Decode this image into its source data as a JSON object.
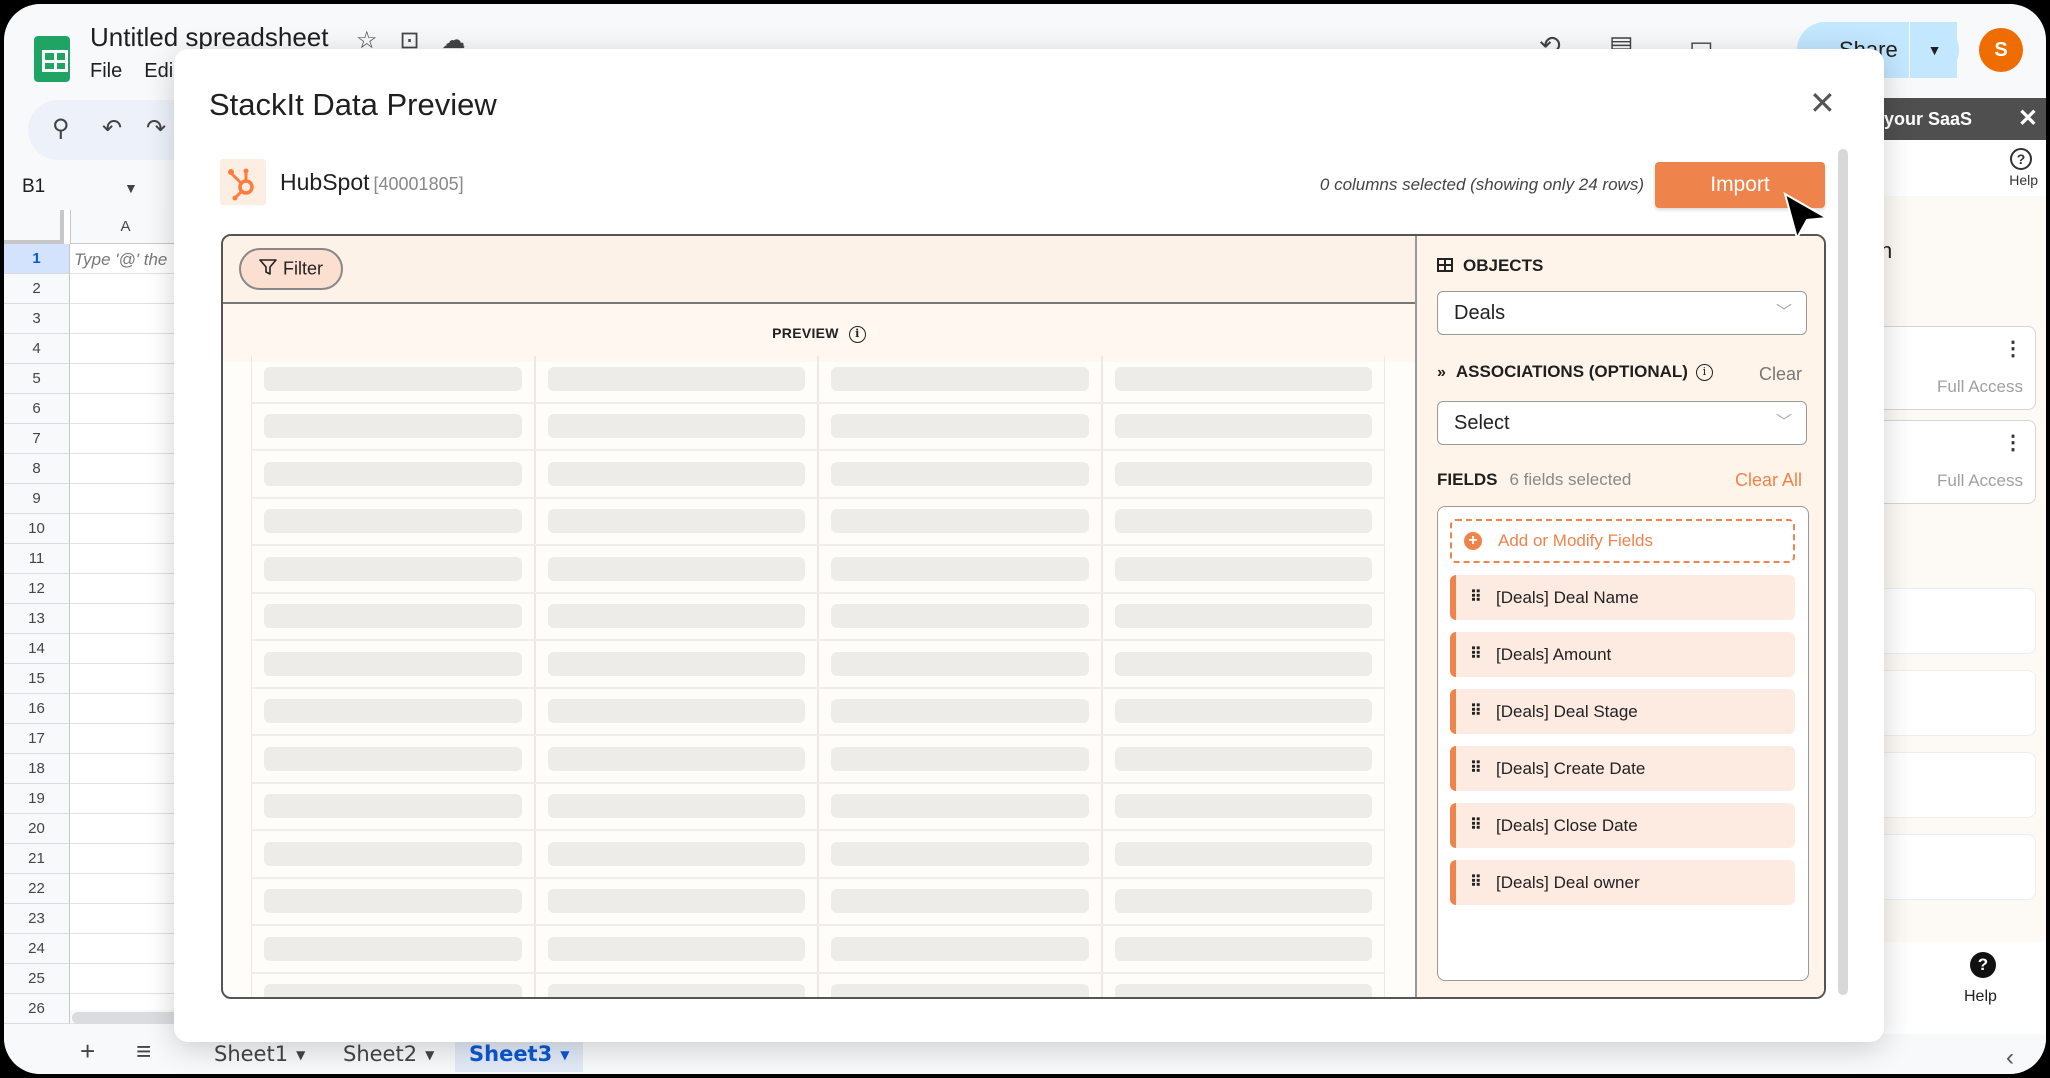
{
  "app": {
    "doc_title": "Untitled spreadsheet",
    "menu": [
      "File",
      "Edi"
    ],
    "title_icons": [
      "star-icon",
      "move-folder-icon",
      "cloud-saved-icon"
    ],
    "toolbar_icons": [
      "search-icon",
      "undo-icon",
      "redo-icon"
    ],
    "header_icons": [
      "history-icon",
      "comment-icon",
      "meet-icon"
    ],
    "share_label": "Share",
    "avatar_initial": "S",
    "colors": {
      "accent": "#ee844b",
      "share_bg": "#c2e7ff",
      "avatar": "#ef6c00",
      "sheets_green": "#1fa463"
    }
  },
  "grid": {
    "name_box": "B1",
    "column_header": "A",
    "a1_hint": "Type '@' the",
    "rows": [
      "1",
      "2",
      "3",
      "4",
      "5",
      "6",
      "7",
      "8",
      "9",
      "10",
      "11",
      "12",
      "13",
      "14",
      "15",
      "16",
      "17",
      "18",
      "19",
      "20",
      "21",
      "22",
      "23",
      "24",
      "25",
      "26"
    ],
    "selected_row": "1"
  },
  "sheet_tabs": {
    "add_icon": "+",
    "list_icon": "≡",
    "tabs": [
      {
        "label": "Sheet1",
        "active": false
      },
      {
        "label": "Sheet2",
        "active": false
      },
      {
        "label": "Sheet3",
        "active": true
      }
    ]
  },
  "side_panel": {
    "header": "your SaaS",
    "help_label": "Help",
    "partial_text": "n",
    "cards": [
      {
        "access": "Full Access"
      },
      {
        "access": "Full Access"
      }
    ],
    "bottom_help": "Help"
  },
  "modal": {
    "title": "StackIt Data Preview",
    "source_name": "HubSpot",
    "source_id": "[40001805]",
    "columns_info": "0 columns selected (showing only 24 rows)",
    "import_label": "Import",
    "filter_label": "Filter",
    "preview_label": "PREVIEW",
    "preview_columns": 4,
    "preview_rows_visible": 14,
    "objects": {
      "title": "OBJECTS",
      "selected": "Deals"
    },
    "associations": {
      "title": "ASSOCIATIONS (OPTIONAL)",
      "clear_label": "Clear",
      "placeholder": "Select"
    },
    "fields": {
      "title": "FIELDS",
      "count_label": "6 fields selected",
      "clear_all_label": "Clear All",
      "add_label": "Add or Modify Fields",
      "items": [
        "[Deals] Deal Name",
        "[Deals] Amount",
        "[Deals] Deal Stage",
        "[Deals] Create Date",
        "[Deals] Close Date",
        "[Deals] Deal owner"
      ]
    }
  }
}
